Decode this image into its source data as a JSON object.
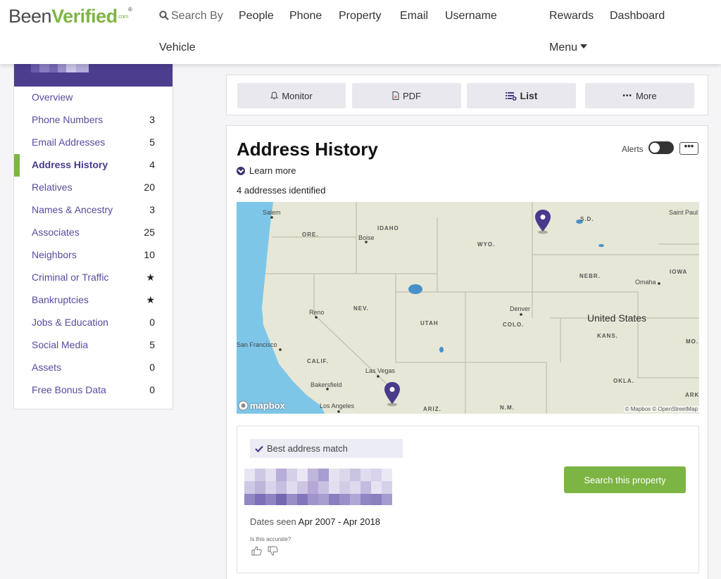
{
  "brand": {
    "logo_been": "Been",
    "logo_verified": "Verified",
    "logo_com": ".com",
    "logo_reg": "®",
    "brand_green": "#7db544",
    "brand_purple": "#4d3d8f"
  },
  "nav": {
    "search_by": "Search By",
    "people": "People",
    "phone": "Phone",
    "property": "Property",
    "email": "Email",
    "username": "Username",
    "vehicle": "Vehicle",
    "rewards": "Rewards",
    "dashboard": "Dashboard",
    "menu": "Menu"
  },
  "sidebar": {
    "items": [
      {
        "label": "Overview",
        "count": ""
      },
      {
        "label": "Phone Numbers",
        "count": "3"
      },
      {
        "label": "Email Addresses",
        "count": "5"
      },
      {
        "label": "Address History",
        "count": "4",
        "active": true
      },
      {
        "label": "Relatives",
        "count": "20"
      },
      {
        "label": "Names & Ancestry",
        "count": "3"
      },
      {
        "label": "Associates",
        "count": "25"
      },
      {
        "label": "Neighbors",
        "count": "10"
      },
      {
        "label": "Criminal or Traffic",
        "count": "★"
      },
      {
        "label": "Bankruptcies",
        "count": "★"
      },
      {
        "label": "Jobs & Education",
        "count": "0"
      },
      {
        "label": "Social Media",
        "count": "5"
      },
      {
        "label": "Assets",
        "count": "0"
      },
      {
        "label": "Free Bonus Data",
        "count": "0"
      }
    ]
  },
  "toolbar": {
    "monitor": "Monitor",
    "pdf": "PDF",
    "list": "List",
    "more": "More"
  },
  "section": {
    "title": "Address History",
    "learn_more": "Learn more",
    "identified": "4 addresses identified",
    "alerts_label": "Alerts",
    "more_dots": "•••"
  },
  "map": {
    "labels": {
      "salem": "Salem",
      "ore": "ORE.",
      "idaho": "IDAHO",
      "boise": "Boise",
      "wyo": "WYO.",
      "sd": "S.D.",
      "saint_paul": "Saint Paul",
      "iowa": "IOWA",
      "nebr": "NEBR.",
      "omaha": "Omaha",
      "nev": "NEV.",
      "reno": "Reno",
      "utah": "UTAH",
      "denver": "Denver",
      "colo": "COLO.",
      "us": "United States",
      "kans": "KANS.",
      "mo": "MO.",
      "sf": "San Francisco",
      "calif": "CALIF.",
      "lasvegas": "Las Vegas",
      "bakersfield": "Bakersfield",
      "okla": "OKLA.",
      "ark": "ARK",
      "la": "Los Angeles",
      "ariz": "ARIZ.",
      "nm": "N.M.",
      "mapbox": "mapbox",
      "attribution": "© Mapbox © OpenStreetMap"
    },
    "land_color": "#e6e7d6",
    "water_color": "#7dc6e8",
    "pin_color": "#4a3a8c"
  },
  "result": {
    "best_match": "Best address match",
    "dates_label": "Dates seen",
    "dates_value": "Apr 2007 - Apr 2018",
    "accurate": "Is this accurate?",
    "search_property": "Search this property"
  }
}
